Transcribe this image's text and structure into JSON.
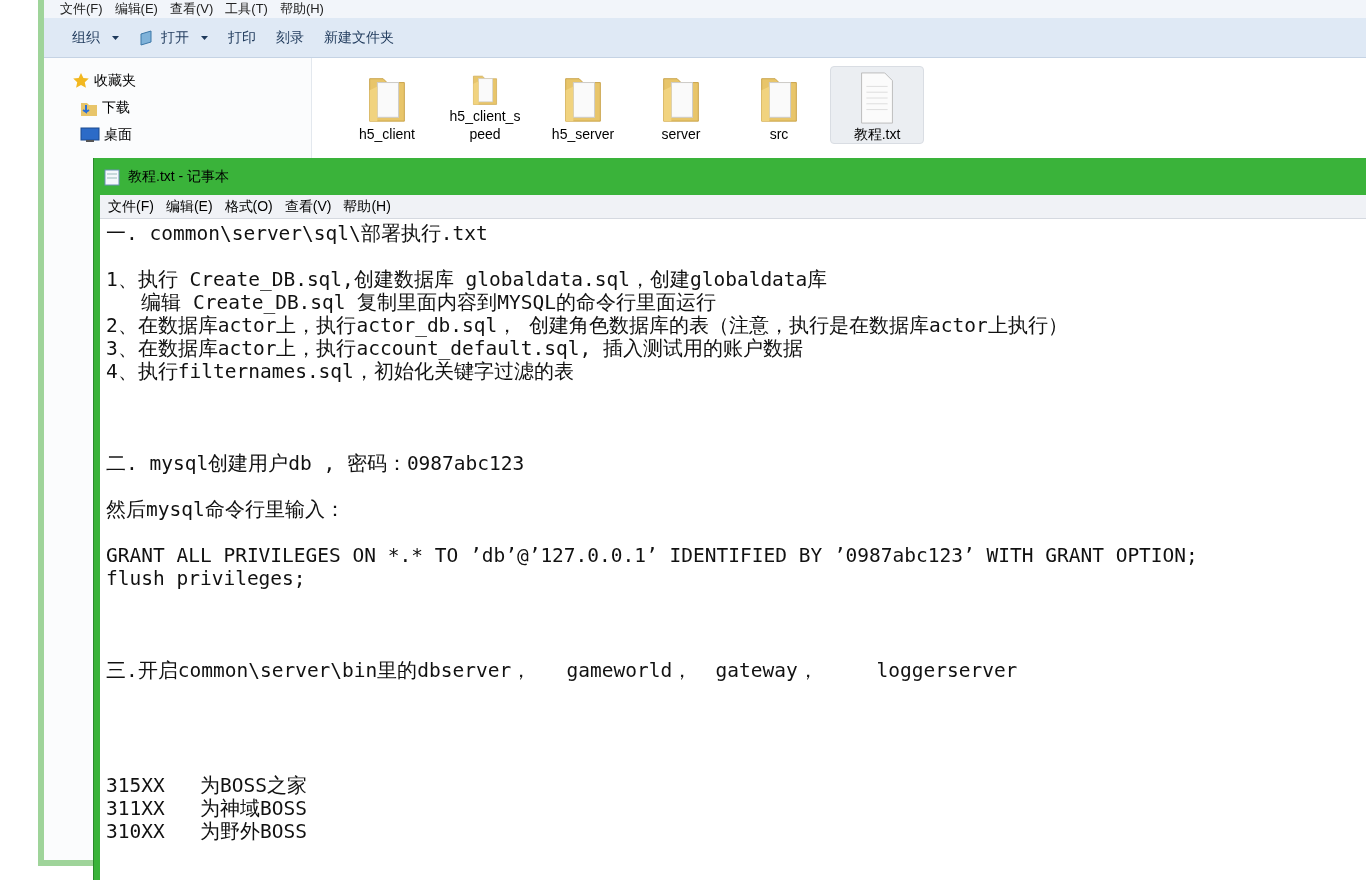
{
  "explorer": {
    "menu": [
      "文件(F)",
      "编辑(E)",
      "查看(V)",
      "工具(T)",
      "帮助(H)"
    ],
    "toolbar": [
      {
        "label": "组织",
        "dropdown": true,
        "icon": false
      },
      {
        "label": "打开",
        "dropdown": true,
        "icon": true
      },
      {
        "label": "打印",
        "dropdown": false,
        "icon": false
      },
      {
        "label": "刻录",
        "dropdown": false,
        "icon": false
      },
      {
        "label": "新建文件夹",
        "dropdown": false,
        "icon": false
      }
    ],
    "sidebar": [
      {
        "label": "收藏夹",
        "kind": "star"
      },
      {
        "label": "下载",
        "kind": "download"
      },
      {
        "label": "桌面",
        "kind": "desktop"
      }
    ],
    "files": [
      {
        "name": "h5_client",
        "kind": "folder",
        "selected": false
      },
      {
        "name": "h5_client_s peed",
        "kind": "folder",
        "selected": false
      },
      {
        "name": "h5_server",
        "kind": "folder",
        "selected": false
      },
      {
        "name": "server",
        "kind": "folder",
        "selected": false
      },
      {
        "name": "src",
        "kind": "folder",
        "selected": false
      },
      {
        "name": "教程.txt",
        "kind": "text",
        "selected": true
      }
    ]
  },
  "notepad": {
    "title": "教程.txt - 记事本",
    "menu": [
      "文件(F)",
      "编辑(E)",
      "格式(O)",
      "查看(V)",
      "帮助(H)"
    ],
    "lines": [
      "一. common\\server\\sql\\部署执行.txt",
      "1、执行 Create_DB.sql,创建数据库 globaldata.sql，创建globaldata库",
      "   编辑 Create_DB.sql 复制里面内容到MYSQL的命令行里面运行",
      "2、在数据库actor上，执行actor_db.sql， 创建角色数据库的表（注意，执行是在数据库actor上执行）",
      "3、在数据库actor上，执行account_default.sql, 插入测试用的账户数据",
      "4、执行filternames.sql，初始化关键字过滤的表",
      "二. mysql创建用户db , 密码：0987abc123",
      "然后mysql命令行里输入：",
      "GRANT ALL PRIVILEGES ON *.* TO ’db’@’127.0.0.1’ IDENTIFIED BY ’0987abc123’ WITH GRANT OPTION;",
      "flush privileges;",
      "三.开启common\\server\\bin里的dbserver，   gameworld，  gateway，     loggerserver",
      "315XX   为BOSS之家",
      "311XX   为神域BOSS",
      "310XX   为野外BOSS"
    ]
  }
}
